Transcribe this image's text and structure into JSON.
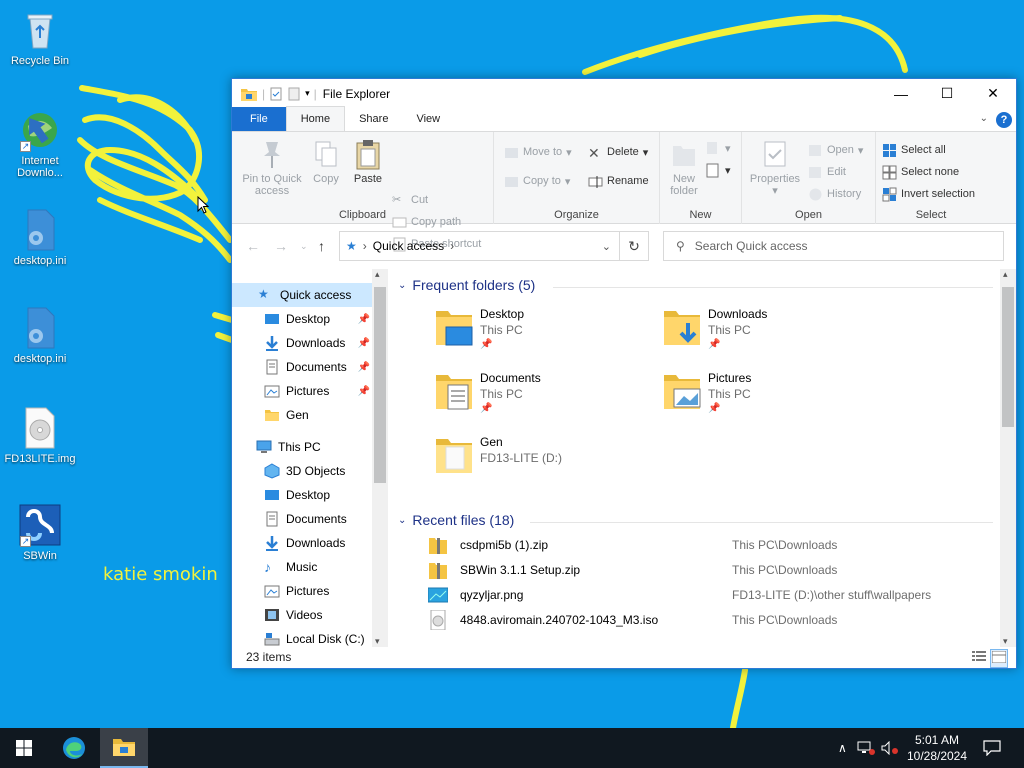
{
  "desktop": {
    "icons": [
      {
        "label": "Recycle Bin"
      },
      {
        "label": "Internet Downlo..."
      },
      {
        "label": "desktop.ini"
      },
      {
        "label": "desktop.ini"
      },
      {
        "label": "FD13LITE.img"
      },
      {
        "label": "SBWin"
      }
    ],
    "wallpaper_text": "katie smokin"
  },
  "window": {
    "title": "File Explorer",
    "controls": {
      "minimize": "—",
      "maximize": "☐",
      "close": "✕"
    },
    "tabs": [
      {
        "label": "File"
      },
      {
        "label": "Home"
      },
      {
        "label": "Share"
      },
      {
        "label": "View"
      }
    ],
    "help": "?",
    "ribbon": {
      "clipboard": {
        "label": "Clipboard",
        "pin": "Pin to Quick access",
        "copy": "Copy",
        "paste": "Paste",
        "cut": "Cut",
        "copy_path": "Copy path",
        "paste_shortcut": "Paste shortcut"
      },
      "organize": {
        "label": "Organize",
        "move_to": "Move to",
        "copy_to": "Copy to",
        "delete": "Delete",
        "rename": "Rename"
      },
      "new": {
        "label": "New",
        "new_folder": "New folder"
      },
      "open": {
        "label": "Open",
        "properties": "Properties",
        "open": "Open",
        "edit": "Edit",
        "history": "History"
      },
      "select": {
        "label": "Select",
        "select_all": "Select all",
        "select_none": "Select none",
        "invert": "Invert selection"
      }
    },
    "address": {
      "crumb": "Quick access",
      "search_placeholder": "Search Quick access"
    },
    "nav": {
      "quick_access": "Quick access",
      "pinned": [
        {
          "label": "Desktop"
        },
        {
          "label": "Downloads"
        },
        {
          "label": "Documents"
        },
        {
          "label": "Pictures"
        },
        {
          "label": "Gen"
        }
      ],
      "this_pc": "This PC",
      "pc_items": [
        {
          "label": "3D Objects"
        },
        {
          "label": "Desktop"
        },
        {
          "label": "Documents"
        },
        {
          "label": "Downloads"
        },
        {
          "label": "Music"
        },
        {
          "label": "Pictures"
        },
        {
          "label": "Videos"
        },
        {
          "label": "Local Disk (C:)"
        }
      ]
    },
    "frequent": {
      "header": "Frequent folders (5)",
      "folders": [
        {
          "name": "Desktop",
          "location": "This PC"
        },
        {
          "name": "Downloads",
          "location": "This PC"
        },
        {
          "name": "Documents",
          "location": "This PC"
        },
        {
          "name": "Pictures",
          "location": "This PC"
        },
        {
          "name": "Gen",
          "location": "FD13-LITE (D:)"
        }
      ]
    },
    "recent": {
      "header": "Recent files (18)",
      "files": [
        {
          "name": "csdpmi5b (1).zip",
          "path": "This PC\\Downloads"
        },
        {
          "name": "SBWin 3.1.1 Setup.zip",
          "path": "This PC\\Downloads"
        },
        {
          "name": "qyzyljar.png",
          "path": "FD13-LITE (D:)\\other stuff\\wallpapers"
        },
        {
          "name": "4848.aviromain.240702-1043_M3.iso",
          "path": "This PC\\Downloads"
        }
      ]
    },
    "status": "23 items"
  },
  "taskbar": {
    "time": "5:01 AM",
    "date": "10/28/2024"
  },
  "colors": {
    "desktop": "#0a9be8",
    "accent": "#1a6fd0",
    "taskbar": "#101820",
    "selection": "#cce8ff",
    "scribble": "#f2f23c"
  }
}
